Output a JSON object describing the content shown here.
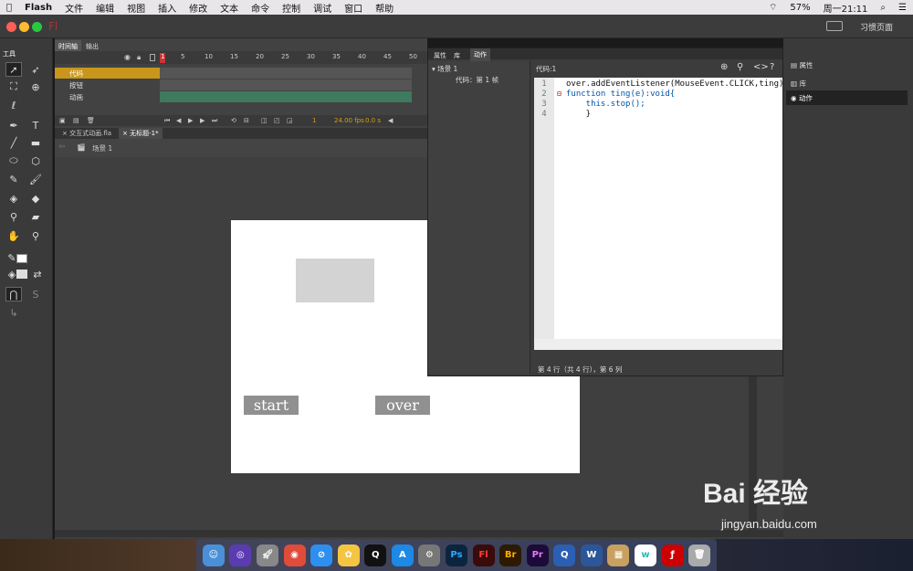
{
  "menubar": {
    "apple": "",
    "app": "Flash",
    "items": [
      "文件",
      "编辑",
      "视图",
      "插入",
      "修改",
      "文本",
      "命令",
      "控制",
      "调试",
      "窗口",
      "帮助"
    ],
    "battery": "57%",
    "clock": "周一21:11"
  },
  "titlebar": {
    "logo": "Fl",
    "workspace": "习惯页面"
  },
  "tools": {
    "label": "工具"
  },
  "timeline": {
    "tabs": [
      "时间轴",
      "输出"
    ],
    "frame_numbers": [
      "1",
      "5",
      "10",
      "15",
      "20",
      "25",
      "30",
      "35",
      "40",
      "45",
      "50"
    ],
    "layers": [
      "代码",
      "按钮",
      "动画"
    ],
    "current_frame": "1",
    "fps": "24.00 fps",
    "time": "0.0 s"
  },
  "doc_tabs": [
    "交互式动画.fla",
    "无标题-1*"
  ],
  "breadcrumb": "场景 1",
  "stage": {
    "button1": "start",
    "button2": "over"
  },
  "actions": {
    "tabs": [
      "属性",
      "库",
      "动作"
    ],
    "tree_scene": "场景 1",
    "tree_code": "代码：第 1 帧",
    "code_tab": "代码:1",
    "code_lines": [
      "over.addEventListener(MouseEvent.CLICK,ting);",
      "function ting(e):void{",
      "    this.stop();",
      "    }"
    ],
    "status": "第 4 行（共 4 行），第 6 列"
  },
  "right_panel": {
    "items": [
      "属性",
      "库",
      "动作"
    ]
  },
  "watermark": {
    "main": "Bai 经验",
    "url": "jingyan.baidu.com"
  },
  "colors": {
    "accent": "#d4a017",
    "menubar": "#e9e6ea",
    "panel": "#3c3c3c",
    "stage": "#ffffff",
    "button": "#909090"
  }
}
